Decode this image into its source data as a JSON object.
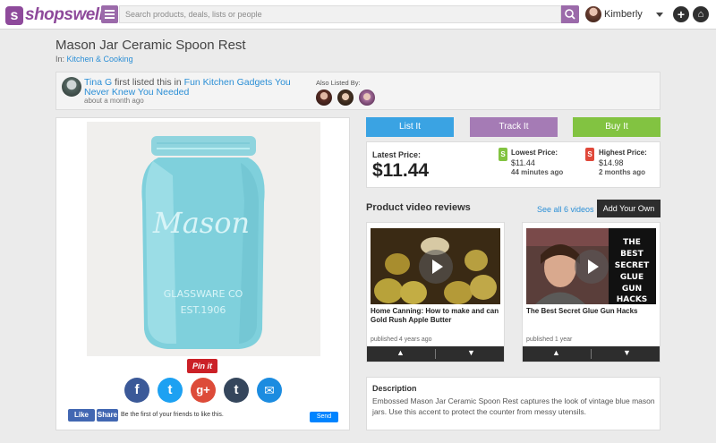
{
  "header": {
    "logo_mark": "s",
    "logo_text": "shopswell",
    "search_placeholder": "Search products, deals, lists or people",
    "username": "Kimberly",
    "add_label": "+",
    "home_label": "⌂"
  },
  "product": {
    "title": "Mason Jar Ceramic Spoon Rest",
    "crumb_prefix": "In:",
    "crumb_link": "Kitchen & Cooking",
    "jar_text_1": "Mason",
    "jar_text_2": "GLASSWARE CO",
    "jar_text_3": "EST.1906"
  },
  "listed": {
    "user": "Tina G",
    "middle": " first listed this in ",
    "list_name": "Fun Kitchen Gadgets You Never Knew You Needed",
    "time": "about a month ago",
    "also_label": "Also Listed By:"
  },
  "social": {
    "pin_label": "Pin it",
    "icons": [
      "facebook-icon",
      "twitter-icon",
      "google-plus-icon",
      "tumblr-icon",
      "email-icon"
    ],
    "glyphs": [
      "f",
      "t",
      "g+",
      "t",
      "✉"
    ],
    "colors": [
      "#3b5998",
      "#1da1f2",
      "#dd4b39",
      "#35465c",
      "#1c8ce0"
    ],
    "fb_like": "Like",
    "fb_share": "Share",
    "fb_text": "Be the first of your friends to like this.",
    "send": "Send"
  },
  "actions": {
    "list_it": "List It",
    "track_it": "Track It",
    "buy_it": "Buy It",
    "colors": {
      "list": "#3aa3e3",
      "track": "#a57bb5",
      "buy": "#82c341"
    }
  },
  "prices": {
    "latest_label": "Latest Price:",
    "latest_value": "$11.44",
    "lowest_label": "Lowest Price:",
    "lowest_value": "$11.44",
    "lowest_since": "44 minutes ago",
    "highest_label": "Highest Price:",
    "highest_value": "$14.98",
    "highest_since": "2 months ago",
    "lowest_tag": "S",
    "highest_tag": "S"
  },
  "videos": {
    "heading": "Product video reviews",
    "see_all": "See all 6 videos",
    "add_own": "Add Your Own",
    "items": [
      {
        "title": "Home Canning: How to make and can Gold Rush Apple Butter",
        "published": "published 4 years ago"
      },
      {
        "title": "The Best Secret Glue Gun Hacks",
        "published": "published 1 year",
        "thumb_text": "THE BEST SECRET GLUE GUN HACKS"
      }
    ]
  },
  "description": {
    "heading": "Description",
    "text": "Embossed Mason Jar Ceramic Spoon Rest captures the look of vintage blue mason jars. Use this accent to protect the counter from messy utensils."
  }
}
